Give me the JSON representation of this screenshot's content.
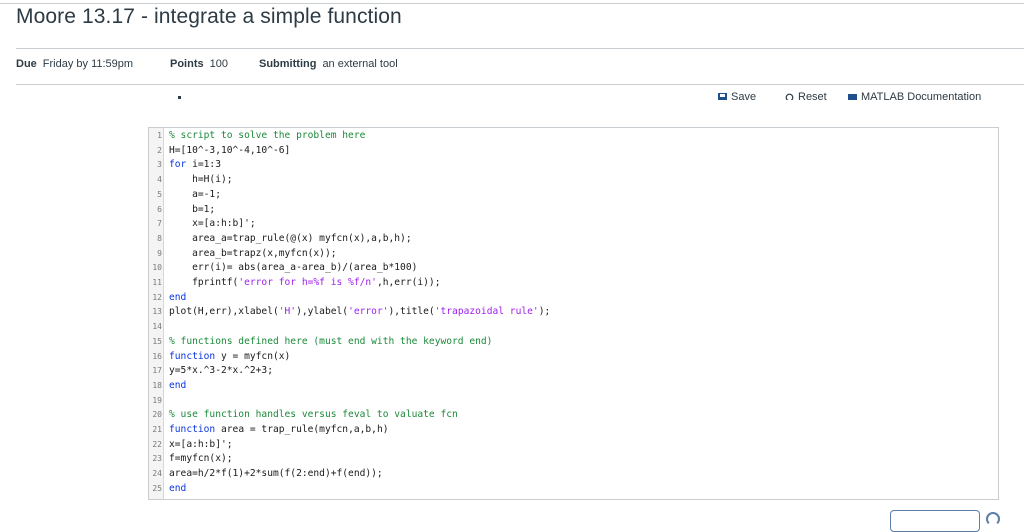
{
  "assignment": {
    "title": "Moore 13.17 - integrate a simple function",
    "meta": [
      {
        "label": "Due",
        "value": "Friday by 11:59pm"
      },
      {
        "label": "Points",
        "value": "100"
      },
      {
        "label": "Submitting",
        "value": "an external tool"
      }
    ]
  },
  "toolbar": {
    "save_label": "Save",
    "reset_label": "Reset",
    "docs_label": "MATLAB Documentation"
  },
  "code_lines": [
    {
      "n": "1",
      "parts": [
        [
          "c",
          "% script to solve the problem here"
        ]
      ]
    },
    {
      "n": "2",
      "parts": [
        [
          "t",
          "H=[10^-3,10^-4,10^-6]"
        ]
      ]
    },
    {
      "n": "3",
      "parts": [
        [
          "k",
          "for"
        ],
        [
          "t",
          " i=1:3"
        ]
      ]
    },
    {
      "n": "4",
      "parts": [
        [
          "t",
          "    h=H(i);"
        ]
      ]
    },
    {
      "n": "5",
      "parts": [
        [
          "t",
          "    a=-1;"
        ]
      ]
    },
    {
      "n": "6",
      "parts": [
        [
          "t",
          "    b=1;"
        ]
      ]
    },
    {
      "n": "7",
      "parts": [
        [
          "t",
          "    x=[a:h:b]';"
        ]
      ]
    },
    {
      "n": "8",
      "parts": [
        [
          "t",
          "    area_a=trap_rule(@(x) myfcn(x),a,b,h);"
        ]
      ]
    },
    {
      "n": "9",
      "parts": [
        [
          "t",
          "    area_b=trapz(x,myfcn(x));"
        ]
      ]
    },
    {
      "n": "10",
      "parts": [
        [
          "t",
          "    err(i)= abs(area_a-area_b)/(area_b*100)"
        ]
      ]
    },
    {
      "n": "11",
      "parts": [
        [
          "t",
          "    fprintf("
        ],
        [
          "s",
          "'error for h=%f is %f/n'"
        ],
        [
          "t",
          ",h,err(i));"
        ]
      ]
    },
    {
      "n": "12",
      "parts": [
        [
          "k",
          "end"
        ]
      ]
    },
    {
      "n": "13",
      "parts": [
        [
          "t",
          "plot(H,err),xlabel("
        ],
        [
          "s",
          "'H'"
        ],
        [
          "t",
          "),ylabel("
        ],
        [
          "s",
          "'error'"
        ],
        [
          "t",
          "),title("
        ],
        [
          "s",
          "'trapazoidal rule'"
        ],
        [
          "t",
          ");"
        ]
      ]
    },
    {
      "n": "14",
      "parts": []
    },
    {
      "n": "15",
      "parts": [
        [
          "c",
          "% functions defined here (must end with the keyword end)"
        ]
      ]
    },
    {
      "n": "16",
      "parts": [
        [
          "k",
          "function"
        ],
        [
          "t",
          " y = myfcn(x)"
        ]
      ]
    },
    {
      "n": "17",
      "parts": [
        [
          "t",
          "y=5*x.^3-2*x.^2+3;"
        ]
      ]
    },
    {
      "n": "18",
      "parts": [
        [
          "k",
          "end"
        ]
      ]
    },
    {
      "n": "19",
      "parts": []
    },
    {
      "n": "20",
      "parts": [
        [
          "c",
          "% use function handles versus feval to valuate fcn"
        ]
      ]
    },
    {
      "n": "21",
      "parts": [
        [
          "k",
          "function"
        ],
        [
          "t",
          " area = trap_rule(myfcn,a,b,h)"
        ]
      ]
    },
    {
      "n": "22",
      "parts": [
        [
          "t",
          "x=[a:h:b]';"
        ]
      ]
    },
    {
      "n": "23",
      "parts": [
        [
          "t",
          "f=myfcn(x);"
        ]
      ]
    },
    {
      "n": "24",
      "parts": [
        [
          "t",
          "area=h/2*f(1)+2*sum(f(2:end)+f(end));"
        ]
      ]
    },
    {
      "n": "25",
      "parts": [
        [
          "k",
          "end"
        ]
      ]
    }
  ]
}
